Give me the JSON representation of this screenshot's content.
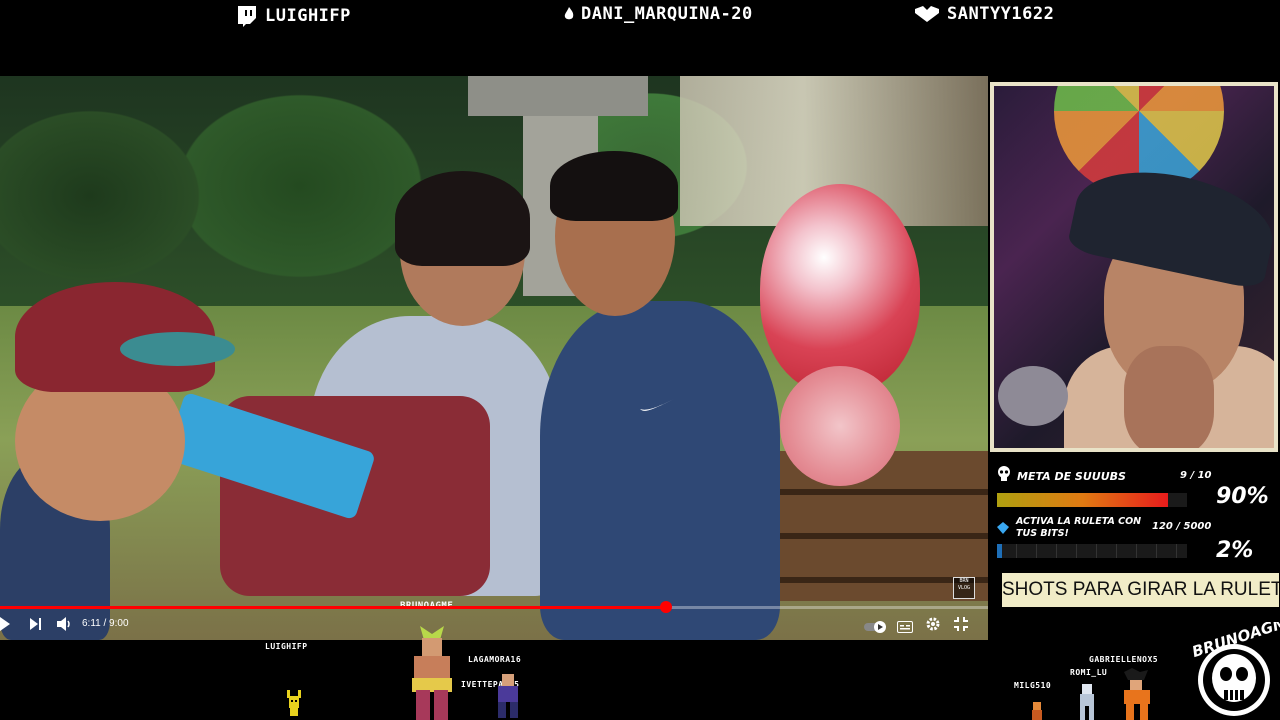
{
  "top_bar": {
    "items": [
      {
        "icon": "twitch-icon",
        "name": "LUIGHIFP"
      },
      {
        "icon": "flame-icon",
        "name": "DANI_MARQUINA-20"
      },
      {
        "icon": "heart-icon",
        "name": "SANTYY1622"
      }
    ]
  },
  "video": {
    "channel_overlay": "BRUNOAGME",
    "watermark": "BRN VLOG",
    "current_time": "6:11",
    "duration": "9:00",
    "time_display": "6:11 / 9:00",
    "progress": 0.674,
    "colors": {
      "progress": "#ff0000"
    }
  },
  "goals": {
    "subs": {
      "label": "META DE SUUUBS",
      "count": "9 / 10",
      "percent": "90%",
      "fraction": 0.9
    },
    "bits": {
      "label_line1": "ACTIVA LA RULETA CON",
      "label_line2": "TUS BITS!",
      "count": "120 / 5000",
      "percent": "2%",
      "fraction": 0.024
    },
    "ticker": "SHOTS PARA GIRAR LA RULETA!"
  },
  "bottom": {
    "chatters": [
      "LUIGHIFP",
      "LAGAMORA16",
      "IVETTEPAH15",
      "GABRIELLENOX5",
      "ROMI_LU",
      "MILG510"
    ],
    "logo_text": "BRUNOAGME"
  }
}
